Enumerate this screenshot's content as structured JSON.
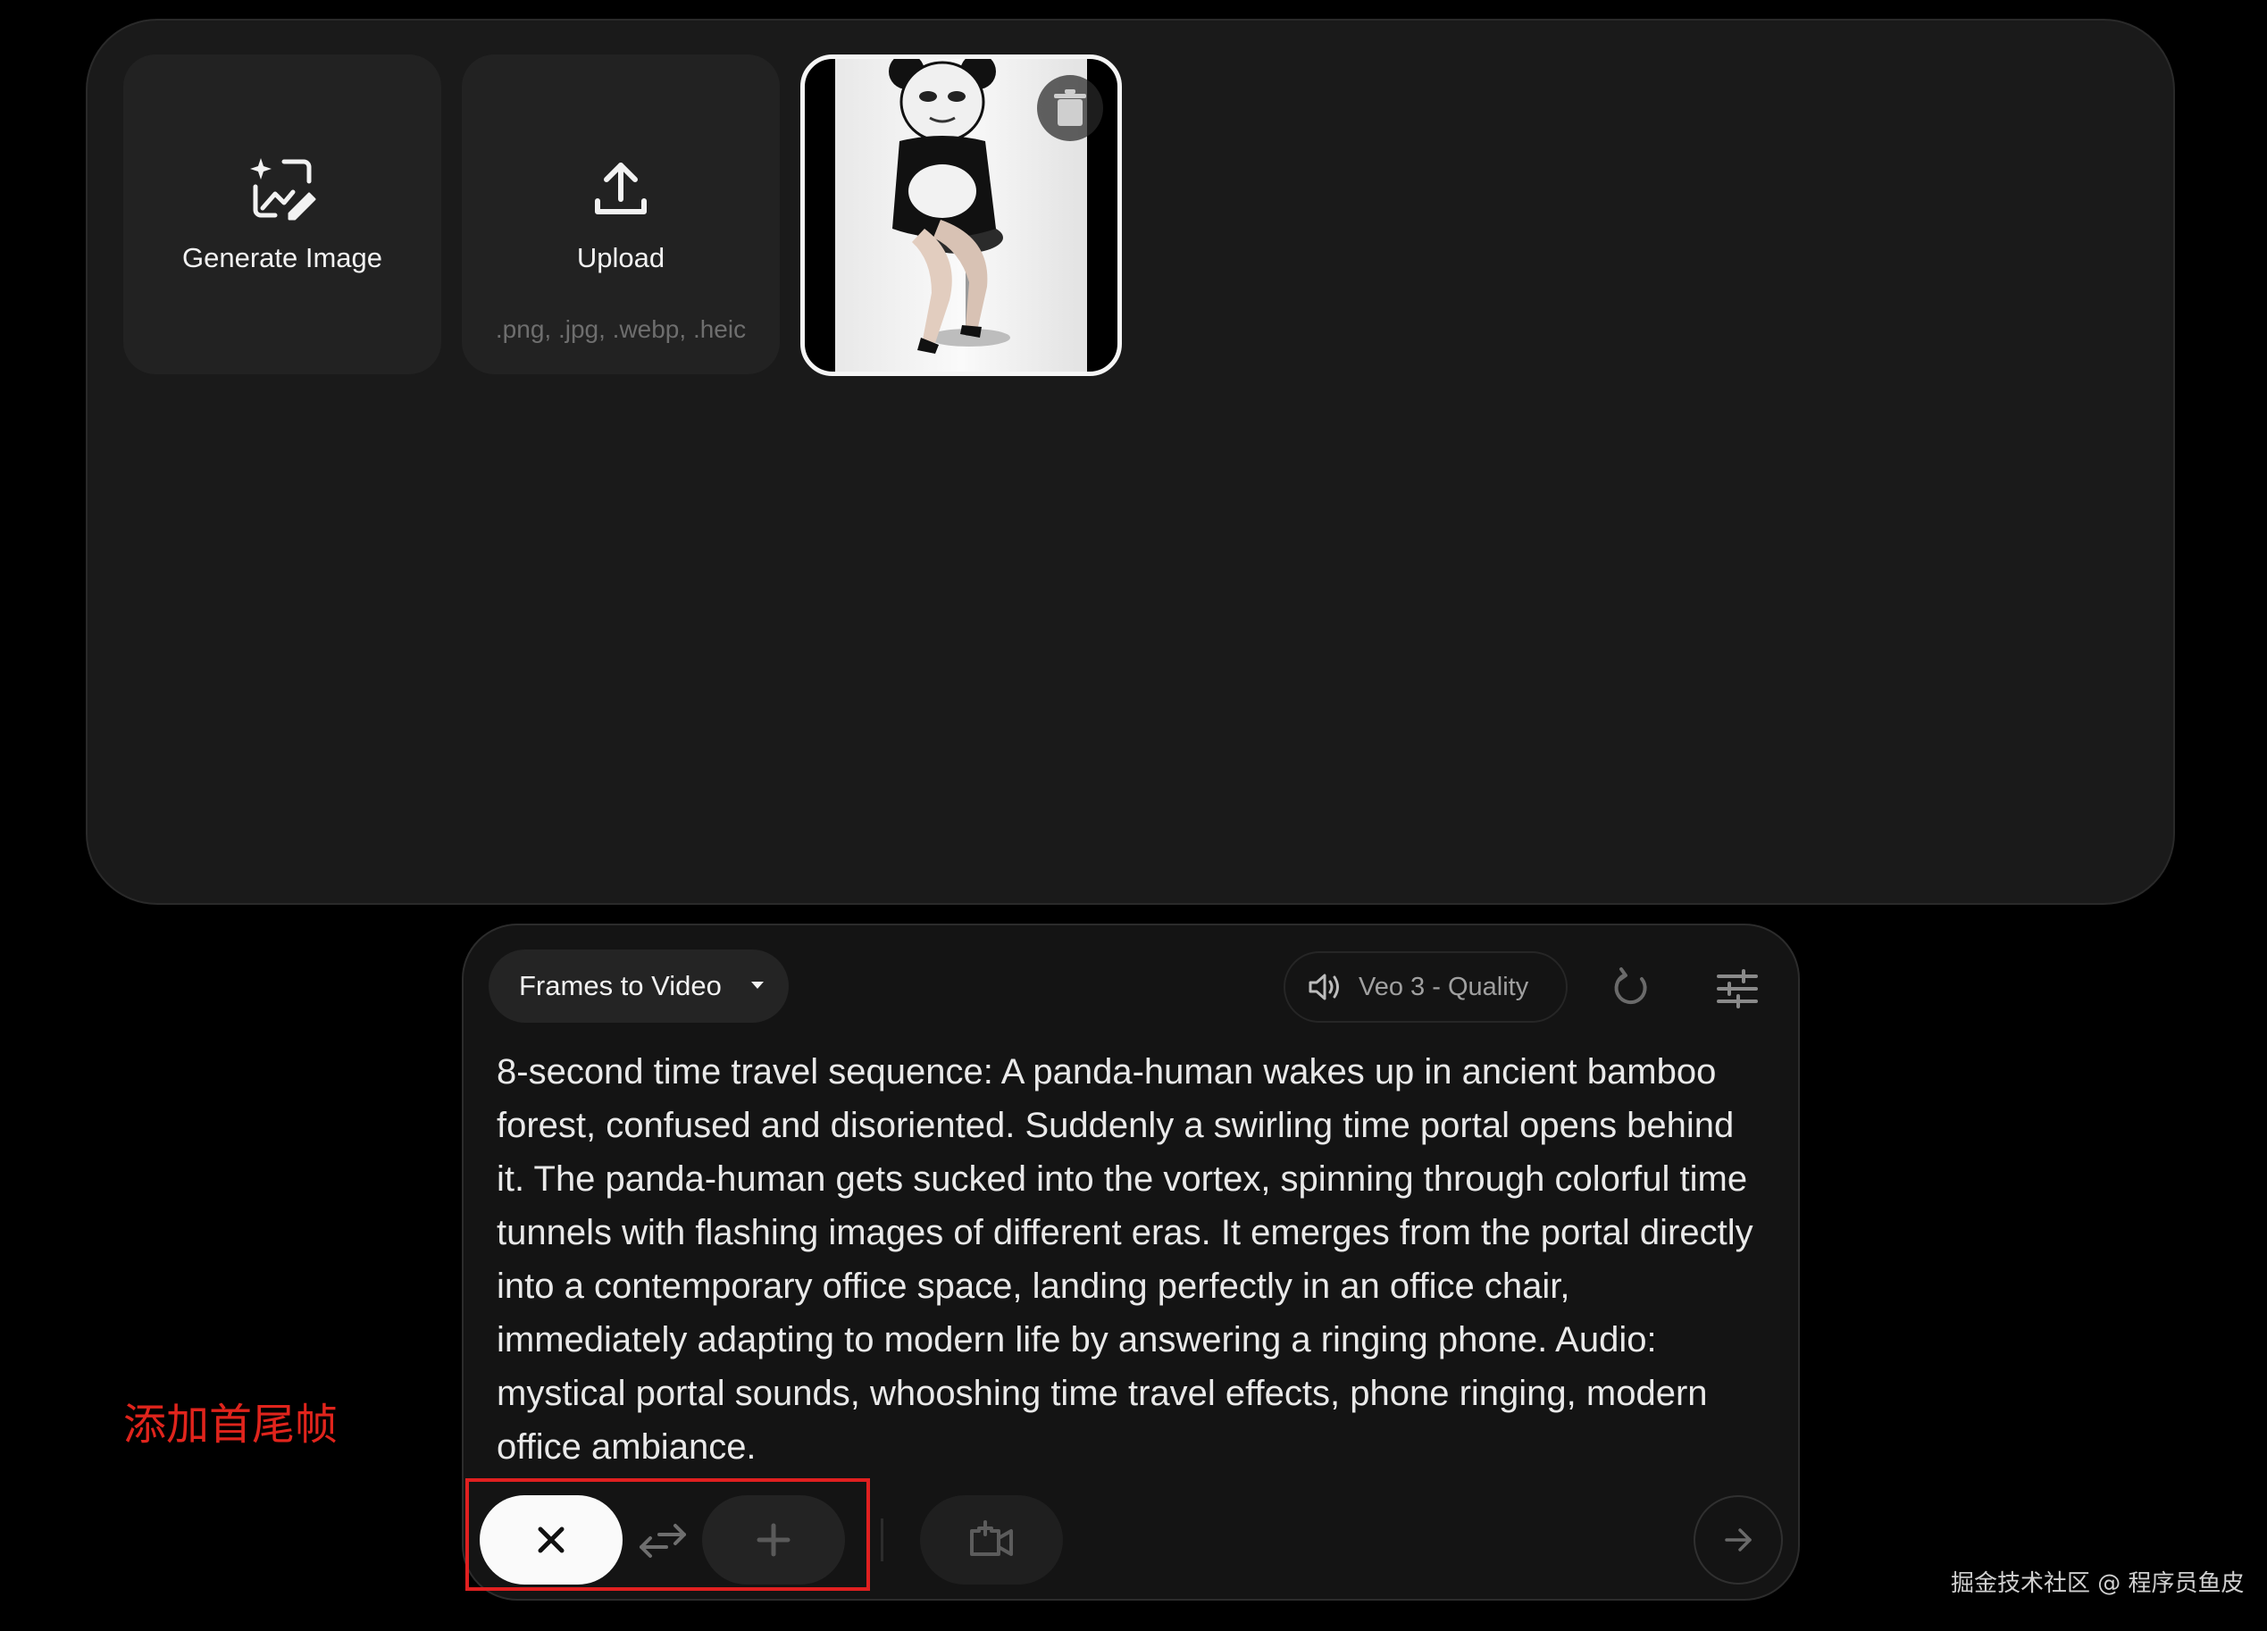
{
  "image_panel": {
    "generate_label": "Generate Image",
    "upload_label": "Upload",
    "upload_formats": ".png, .jpg, .webp, .heic"
  },
  "prompt_panel": {
    "mode_label": "Frames to Video",
    "model_label": "Veo 3 - Quality",
    "prompt_text": "8-second time travel sequence: A panda-human wakes up in ancient bamboo forest, confused and disoriented. Suddenly a swirling time portal opens behind it. The panda-human gets sucked into the vortex, spinning through colorful time tunnels with flashing images of different eras. It emerges from the portal directly into a contemporary office space, landing perfectly in an office chair, immediately adapting to modern life by answering a ringing phone. Audio: mystical portal sounds, whooshing time travel effects, phone ringing, modern office ambiance."
  },
  "icons": {
    "generate": "image-sparkle-icon",
    "upload": "upload-icon",
    "delete": "trash-icon",
    "dropdown": "caret-down-icon",
    "audio": "speaker-icon",
    "refresh": "refresh-icon",
    "settings": "sliders-icon",
    "close_frame": "close-icon",
    "swap": "swap-arrows-icon",
    "add_frame": "plus-icon",
    "add_video": "video-plus-icon",
    "send": "arrow-right-icon"
  },
  "annotation": {
    "label": "添加首尾帧",
    "color": "#e02020"
  },
  "watermark": "掘金技术社区 @ 程序员鱼皮"
}
